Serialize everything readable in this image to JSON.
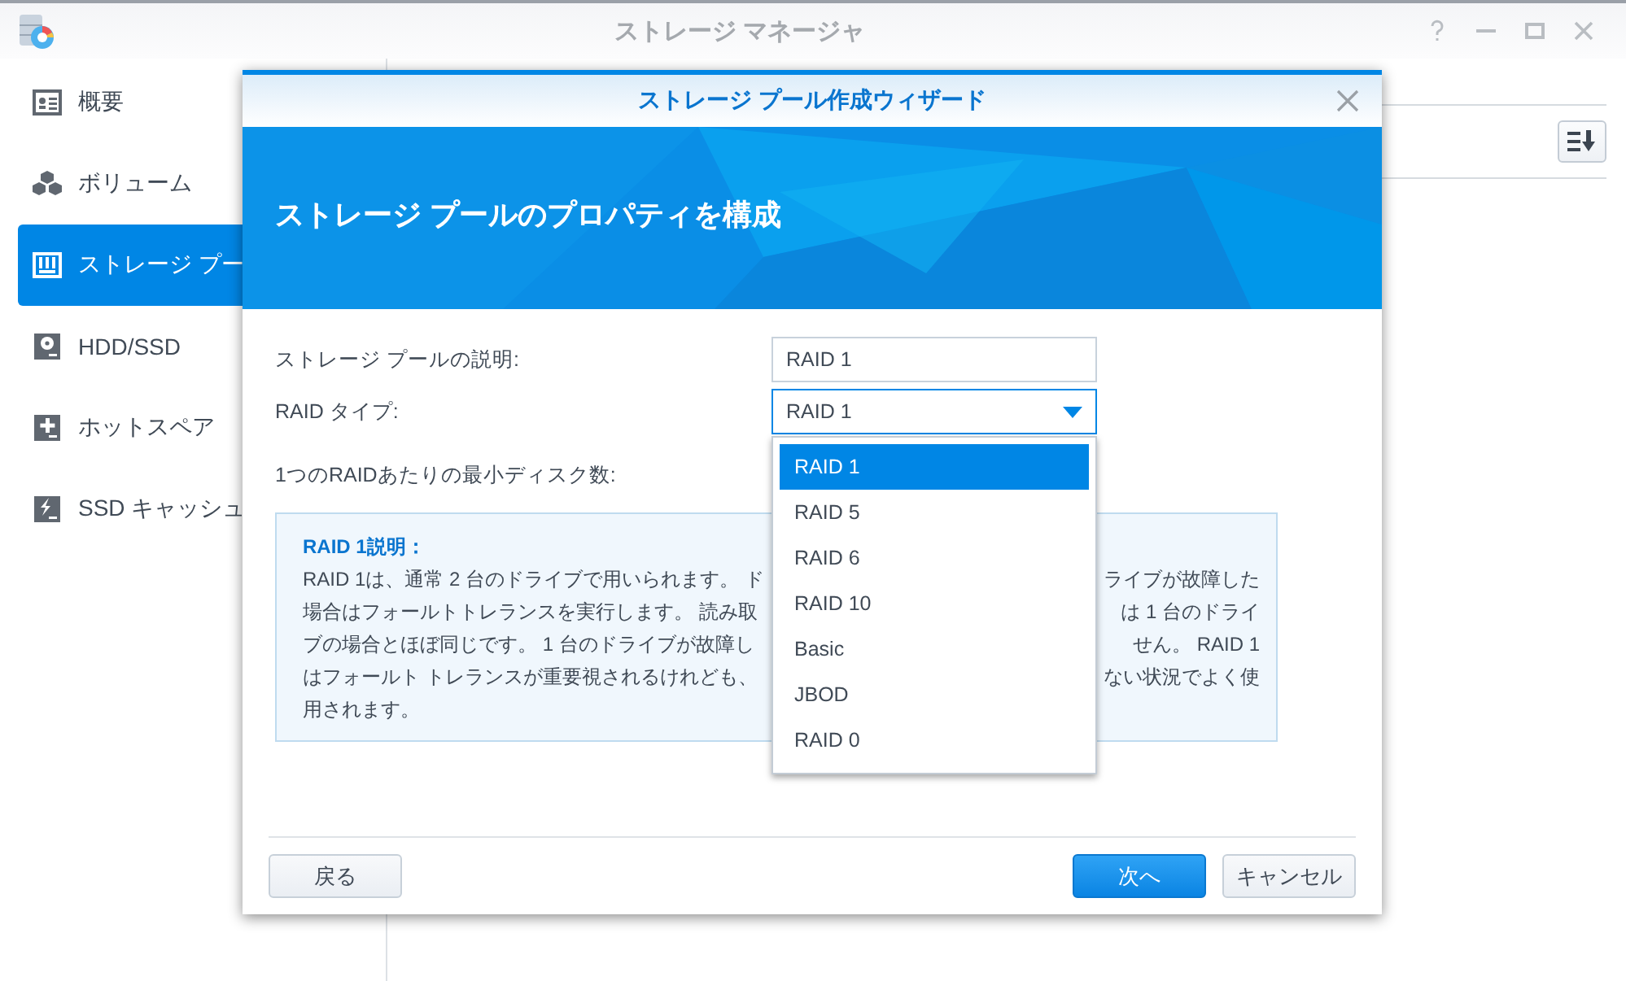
{
  "window": {
    "title": "ストレージ マネージャ"
  },
  "sidebar": {
    "items": [
      {
        "label": "概要",
        "selected": false
      },
      {
        "label": "ボリューム",
        "selected": false
      },
      {
        "label": "ストレージ プー",
        "selected": true
      },
      {
        "label": "HDD/SSD",
        "selected": false
      },
      {
        "label": "ホットスペア",
        "selected": false
      },
      {
        "label": "SSD キャッシュ",
        "selected": false
      }
    ]
  },
  "dialog": {
    "title": "ストレージ プール作成ウィザード",
    "heading": "ストレージ プールのプロパティを構成",
    "fields": [
      {
        "label": "ストレージ プールの説明:",
        "kind": "text",
        "value": "RAID 1"
      },
      {
        "label": "RAID タイプ:",
        "kind": "select",
        "value": "RAID 1"
      },
      {
        "label": "1つのRAIDあたりの最小ディスク数:",
        "kind": "info"
      }
    ],
    "dropdown": {
      "options": [
        {
          "label": "RAID 1",
          "selected": true
        },
        {
          "label": "RAID 5",
          "selected": false
        },
        {
          "label": "RAID 6",
          "selected": false
        },
        {
          "label": "RAID 10",
          "selected": false
        },
        {
          "label": "Basic",
          "selected": false
        },
        {
          "label": "JBOD",
          "selected": false
        },
        {
          "label": "RAID 0",
          "selected": false
        }
      ]
    },
    "info": {
      "title": "RAID 1説明：",
      "lines": [
        {
          "left": "RAID 1は、通常 2 台のドライブで用いられます。 ド",
          "right": "ライブが故障した"
        },
        {
          "left": "場合はフォールトトレランスを実行します。 読み取",
          "right": "は 1 台のドライ"
        },
        {
          "left": "ブの場合とほぼ同じです。 1 台のドライブが故障し",
          "right": "せん。 RAID 1"
        },
        {
          "left": "はフォールト トレランスが重要視されるけれども、",
          "right": "ない状況でよく使"
        },
        {
          "left": "用されます。"
        }
      ]
    },
    "buttons": [
      {
        "label": "戻る",
        "kind": "secondary"
      },
      {
        "label": "次へ",
        "kind": "primary"
      },
      {
        "label": "キャンセル",
        "kind": "secondary"
      }
    ]
  }
}
